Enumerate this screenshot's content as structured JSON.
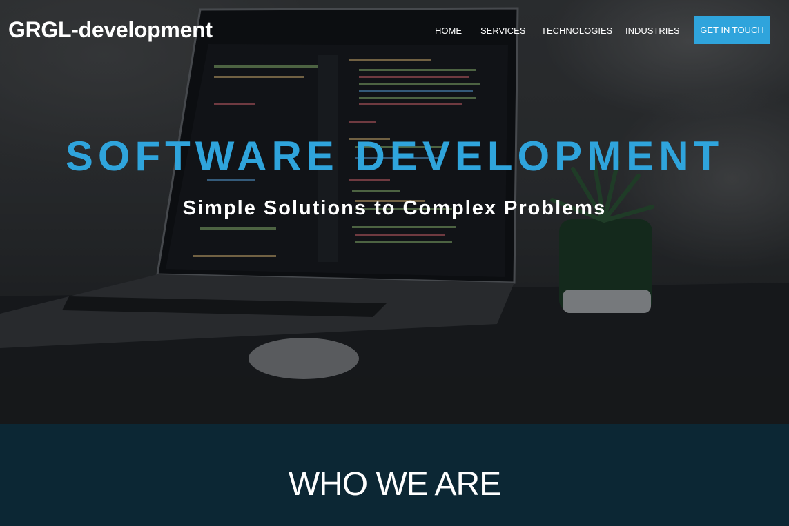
{
  "header": {
    "logo": "GRGL-development",
    "nav": [
      {
        "label": "HOME"
      },
      {
        "label": "SERVICES"
      },
      {
        "label": "TECHNOLOGIES"
      },
      {
        "label": "INDUSTRIES"
      }
    ],
    "cta_label": "GET IN TOUCH"
  },
  "hero": {
    "title": "SOFTWARE DEVELOPMENT",
    "subtitle": "Simple Solutions to Complex Problems"
  },
  "about": {
    "title": "WHO WE ARE"
  },
  "colors": {
    "accent": "#2fa4dc",
    "dark_section": "#0c2734",
    "text_light": "#ffffff"
  }
}
